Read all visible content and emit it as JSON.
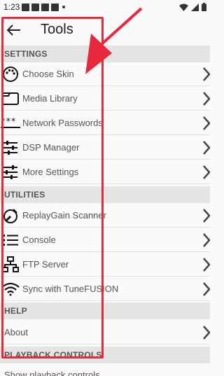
{
  "status_bar": {
    "time": "1:23"
  },
  "app_bar": {
    "title": "Tools"
  },
  "sections": {
    "settings": "SETTINGS",
    "utilities": "UTILITIES",
    "help": "HELP",
    "playback": "PLAYBACK CONTROLS"
  },
  "settings_items": [
    {
      "label": "Choose Skin",
      "icon": "palette-icon"
    },
    {
      "label": "Media Library",
      "icon": "folder-icon"
    },
    {
      "label": "Network Passwords",
      "icon": "password-icon"
    },
    {
      "label": "DSP Manager",
      "icon": "equalizer-icon"
    },
    {
      "label": "More Settings",
      "icon": "sliders-icon"
    }
  ],
  "utilities_items": [
    {
      "label": "ReplayGain Scanner",
      "icon": "gauge-icon"
    },
    {
      "label": "Console",
      "icon": "list-icon"
    },
    {
      "label": "FTP Server",
      "icon": "network-icon"
    },
    {
      "label": "Sync with TuneFUSION",
      "icon": "wifi-icon"
    }
  ],
  "help_items": [
    {
      "label": "About"
    }
  ],
  "playback_items": [
    {
      "label": "Show playback controls"
    }
  ],
  "annotation": {
    "box_color": "#e8283c",
    "arrow_color": "#e8283c"
  }
}
